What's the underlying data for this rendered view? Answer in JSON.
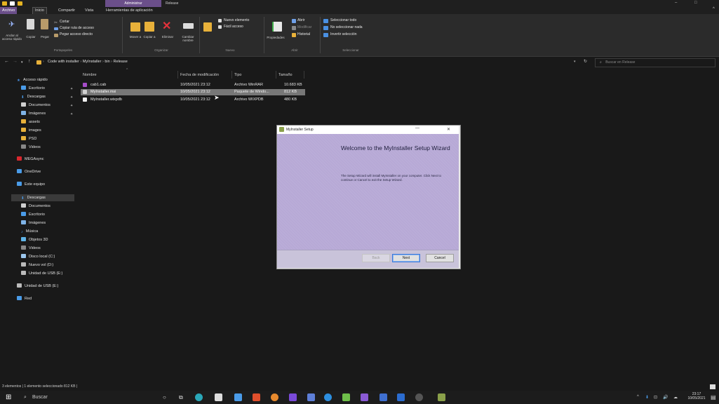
{
  "titlebar": {
    "contextual_tab": "Administrar",
    "window_title": "Release",
    "minimize": "–",
    "maximize": "□"
  },
  "tabs": [
    "Archivo",
    "Inicio",
    "Compartir",
    "Vista",
    "Herramientas de aplicación"
  ],
  "ribbon": {
    "clipboard": {
      "pin": "Anclar al acceso rápido",
      "copy": "Copiar",
      "paste": "Pegar",
      "cut": "Cortar",
      "copy_path": "Copiar ruta de acceso",
      "paste_shortcut": "Pegar acceso directo",
      "group": "Portapapeles"
    },
    "organize": {
      "move": "Mover a",
      "copy_to": "Copiar a",
      "delete": "Eliminar",
      "rename": "Cambiar nombre",
      "new_folder": "Nueva carpeta",
      "group": "Organizar"
    },
    "new": {
      "new_item": "Nuevo elemento",
      "easy_access": "Fácil acceso",
      "group": "Nuevo"
    },
    "open": {
      "properties": "Propiedades",
      "open": "Abrir",
      "edit": "Modificar",
      "history": "Historial",
      "group": "Abrir"
    },
    "select": {
      "select_all": "Seleccionar todo",
      "select_none": "No seleccionar nada",
      "invert": "Invertir selección",
      "group": "Seleccionar"
    }
  },
  "address": {
    "crumbs": [
      "Code with installer",
      "MyInstaller",
      "bin",
      "Release"
    ],
    "search_placeholder": "Buscar en Release"
  },
  "nav_pane": {
    "quick_access": "Acceso rápido",
    "quick_items": [
      "Escritorio",
      "Descargas",
      "Documentos",
      "Imágenes",
      "assets",
      "images",
      "PSD",
      "Videos"
    ],
    "mega": "MEGAsync",
    "onedrive": "OneDrive",
    "this_pc": "Este equipo",
    "pc_items": [
      "Descargas",
      "Documentos",
      "Escritorio",
      "Imágenes",
      "Música",
      "Objetos 3D",
      "Videos",
      "Disco local (C:)",
      "Nuevo vol (D:)",
      "Unidad de USB (E:)"
    ],
    "usb": "Unidad de USB (E:)",
    "network": "Red"
  },
  "file_list": {
    "columns": [
      "Nombre",
      "Fecha de modificación",
      "Tipo",
      "Tamaño"
    ],
    "rows": [
      {
        "name": "cab1.cab",
        "date": "10/05/2021 23:12",
        "type": "Archivo WinRAR",
        "size": "10.683 KB"
      },
      {
        "name": "MyInstaller.msi",
        "date": "10/05/2021 23:12",
        "type": "Paquete de Windo...",
        "size": "812 KB"
      },
      {
        "name": "MyInstaller.wixpdb",
        "date": "10/05/2021 23:12",
        "type": "Archivo WIXPDB",
        "size": "480 KB"
      }
    ]
  },
  "dialog": {
    "title": "MyInstaller Setup",
    "heading": "Welcome to the MyInstaller Setup Wizard",
    "body": "The Setup Wizard will install MyInstaller on your computer. Click Next to continue or Cancel to exit the Setup Wizard.",
    "back": "Back",
    "next": "Next",
    "cancel": "Cancel",
    "close": "✕",
    "minimize": "—"
  },
  "status_bar": "3 elementos  |  1 elemento seleccionado  812 KB  |",
  "taskbar": {
    "search": "Buscar",
    "time": "23:17",
    "date": "10/05/2021"
  }
}
